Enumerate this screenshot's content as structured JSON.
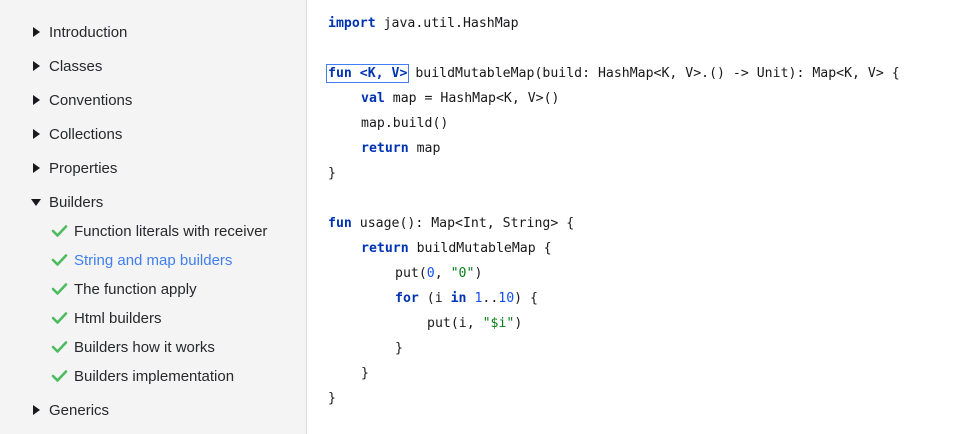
{
  "sidebar": {
    "items": [
      {
        "label": "Introduction",
        "expanded": false
      },
      {
        "label": "Classes",
        "expanded": false
      },
      {
        "label": "Conventions",
        "expanded": false
      },
      {
        "label": "Collections",
        "expanded": false
      },
      {
        "label": "Properties",
        "expanded": false
      },
      {
        "label": "Builders",
        "expanded": true
      },
      {
        "label": "Generics",
        "expanded": false
      }
    ],
    "builders_children": [
      {
        "label": "Function literals with receiver",
        "done": true,
        "active": false
      },
      {
        "label": "String and map builders",
        "done": true,
        "active": true
      },
      {
        "label": "The function apply",
        "done": true,
        "active": false
      },
      {
        "label": "Html builders",
        "done": true,
        "active": false
      },
      {
        "label": "Builders how it works",
        "done": true,
        "active": false
      },
      {
        "label": "Builders implementation",
        "done": true,
        "active": false
      }
    ]
  },
  "colors": {
    "check": "#4dbb5f",
    "active_link": "#3f7ff1",
    "keyword": "#0033b3",
    "number": "#1750eb",
    "string": "#067d17"
  },
  "code": {
    "l1_kw": "import",
    "l1_rest": " java.util.HashMap",
    "l2_sel": "fun <K, V>",
    "l2_rest": " buildMutableMap(build: HashMap<K, V>.() -> Unit): Map<K, V> {",
    "l3_kw": "val",
    "l3_rest": " map = HashMap<K, V>()",
    "l4": "map.build()",
    "l5_kw": "return",
    "l5_rest": " map",
    "l6": "}",
    "l7_kw": "fun",
    "l7_rest": " usage(): Map<Int, String> {",
    "l8_kw": "return",
    "l8_rest": " buildMutableMap {",
    "l9_a": "put(",
    "l9_num": "0",
    "l9_b": ", ",
    "l9_str": "\"0\"",
    "l9_c": ")",
    "l10_kw1": "for",
    "l10_a": " (i ",
    "l10_kw2": "in",
    "l10_b": " ",
    "l10_num1": "1",
    "l10_c": "..",
    "l10_num2": "10",
    "l10_d": ") {",
    "l11_a": "put(i, ",
    "l11_str": "\"$i\"",
    "l11_b": ")",
    "l12": "}",
    "l13": "}",
    "l14": "}"
  }
}
